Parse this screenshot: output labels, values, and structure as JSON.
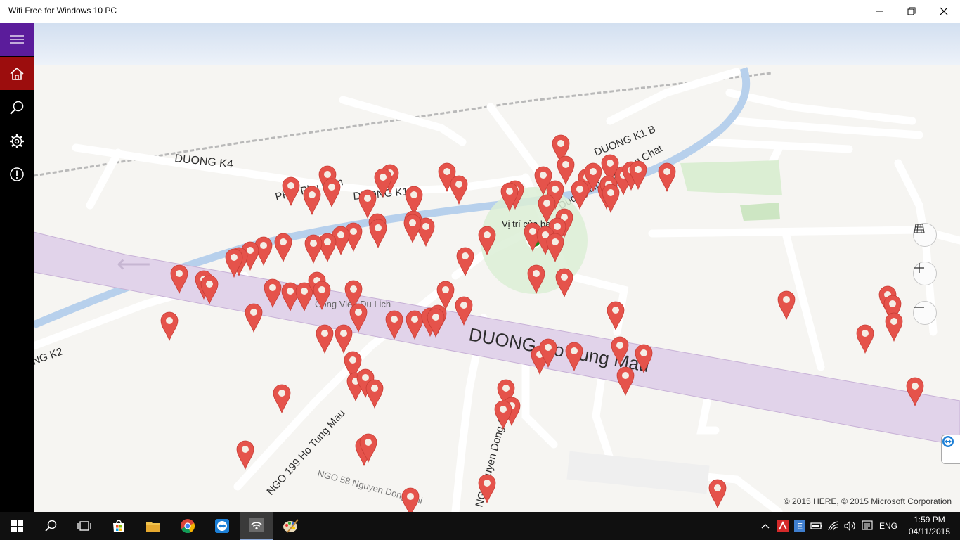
{
  "window": {
    "title": "Wifi Free for Windows 10 PC",
    "minimize_icon": "minimize-icon",
    "maximize_icon": "restore-icon",
    "close_icon": "close-icon"
  },
  "sidebar": {
    "items": [
      {
        "name": "menu",
        "icon": "hamburger-icon"
      },
      {
        "name": "home",
        "icon": "home-icon"
      },
      {
        "name": "search",
        "icon": "search-icon"
      },
      {
        "name": "settings",
        "icon": "gear-icon"
      },
      {
        "name": "about",
        "icon": "info-icon"
      }
    ],
    "accent_color": "#5b1c9b",
    "home_color": "#9c0d0d"
  },
  "map": {
    "street_labels": {
      "duong_k4": "DUONG  K4",
      "pho_phu_dien": "PHO  Phu  Dien",
      "duong_k1b_left": "DUONG  K1  B",
      "duong_k1b_right": "DUONG  K1  B",
      "hoang_cong_chat": "Duong Hoang Cong Chat",
      "duong_k2": "NG  K2",
      "ho_tung_mau": "DUONG  Ho  Tung  Mau",
      "ngo_199": "NGO  199  Ho  Tung  Mau",
      "nguyen_dong_chi": "NG  Nguyen  Dong  Chi",
      "ngo_58": "NGO  58  Nguyen  Dong  Chi",
      "du_lich": "Cong Vien Du Lich"
    },
    "user_location_label": "Vị trí của bạn",
    "pin_color": "#e5534b",
    "location_color": "#1a8a1a",
    "controls": {
      "map_style_icon": "map-style-icon",
      "zoom_in_icon": "zoom-in-icon",
      "zoom_out_icon": "zoom-out-icon"
    },
    "copyright": "© 2015 HERE, © 2015 Microsoft Corporation",
    "teamviewer_icon": "teamviewer-icon"
  },
  "taskbar": {
    "start_icon": "windows-start-icon",
    "apps": [
      {
        "name": "search",
        "icon": "search-icon"
      },
      {
        "name": "task-view",
        "icon": "task-view-icon"
      },
      {
        "name": "store",
        "icon": "store-icon"
      },
      {
        "name": "file-explorer",
        "icon": "folder-icon"
      },
      {
        "name": "chrome",
        "icon": "chrome-icon"
      },
      {
        "name": "teamviewer",
        "icon": "teamviewer-icon"
      },
      {
        "name": "wifi-free",
        "icon": "wifi-app-icon"
      },
      {
        "name": "paint",
        "icon": "paint-icon"
      }
    ],
    "tray": {
      "language": "ENG",
      "time": "1:59 PM",
      "date": "04/11/2015"
    }
  }
}
